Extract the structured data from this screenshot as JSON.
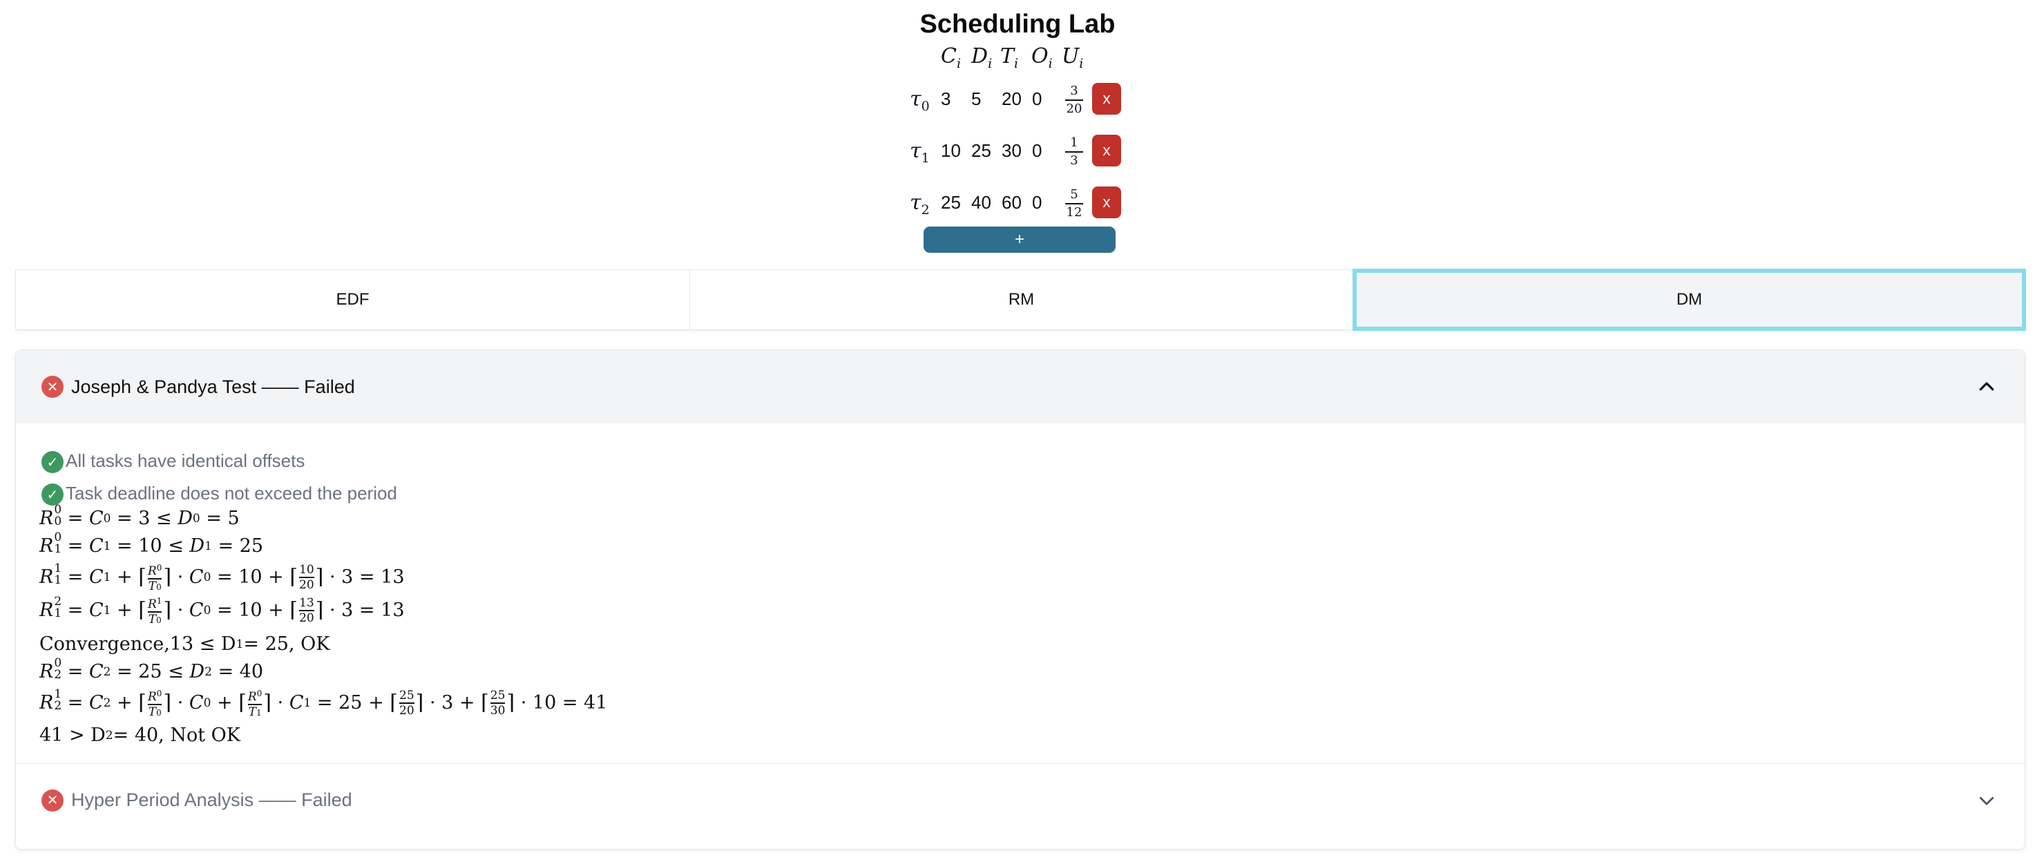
{
  "title": "Scheduling Lab",
  "columns": [
    "C",
    "D",
    "T",
    "O",
    "U"
  ],
  "col_sub": "i",
  "tasks": [
    {
      "name": "τ",
      "sub": "0",
      "C": "3",
      "D": "5",
      "T": "20",
      "O": "0",
      "U_num": "3",
      "U_den": "20",
      "remove": "x"
    },
    {
      "name": "τ",
      "sub": "1",
      "C": "10",
      "D": "25",
      "T": "30",
      "O": "0",
      "U_num": "1",
      "U_den": "3",
      "remove": "x"
    },
    {
      "name": "τ",
      "sub": "2",
      "C": "25",
      "D": "40",
      "T": "60",
      "O": "0",
      "U_num": "5",
      "U_den": "12",
      "remove": "x"
    }
  ],
  "add_label": "+",
  "tabs": [
    {
      "label": "EDF",
      "active": false
    },
    {
      "label": "RM",
      "active": false
    },
    {
      "label": "DM",
      "active": true
    }
  ],
  "accordions": [
    {
      "title": "Joseph & Pandya Test —— Failed",
      "status": "failed",
      "expanded": true,
      "checks": [
        "All tasks have identical offsets",
        "Task deadline does not exceed the period"
      ],
      "lines": {
        "conv_text": "Convergence,13 ≤ D",
        "conv_sub": "1",
        "conv_tail": " = 25, OK",
        "final_text": "41 > D",
        "final_sub": "2",
        "final_tail": " = 40, Not OK"
      }
    },
    {
      "title": "Hyper Period Analysis —— Failed",
      "status": "failed",
      "expanded": false
    }
  ],
  "colors": {
    "remove": "#c0312a",
    "add": "#2f6e8d",
    "fail": "#d9534f",
    "ok": "#3e9960",
    "active_tab_border": "#86dce9"
  }
}
